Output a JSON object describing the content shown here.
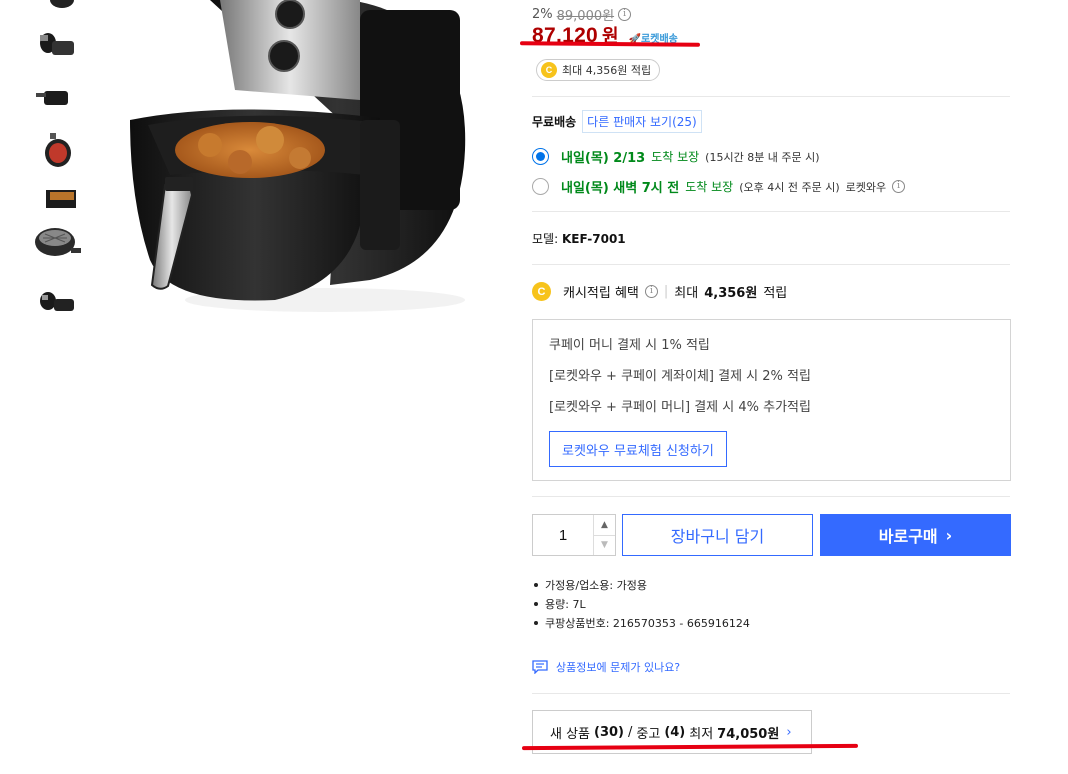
{
  "thumbnails": [
    {
      "icon": "airfryer-top-thumb"
    },
    {
      "icon": "airfryer-basket-thumb"
    },
    {
      "icon": "airfryer-drawer-thumb"
    },
    {
      "icon": "airfryer-red-thumb"
    },
    {
      "icon": "airfryer-food-thumb"
    },
    {
      "icon": "airfryer-basket-open-thumb"
    },
    {
      "icon": "airfryer-parts-thumb"
    }
  ],
  "price": {
    "discount": "2%",
    "original": "89,000원",
    "info_icon": "i",
    "sale": "87,120",
    "currency": "원",
    "rocket_badge": "🚀로켓배송",
    "annotation_color": "#e60012"
  },
  "cash_pill": {
    "coin": "C",
    "text": "최대 4,356원 적립"
  },
  "shipping": {
    "label": "무료배송",
    "other_sellers": "다른 판매자 보기(25)",
    "options": [
      {
        "selected": true,
        "day": "내일(목) 2/13",
        "guarantee": "도착 보장",
        "note": "(15시간 8분 내 주문 시)",
        "extra": ""
      },
      {
        "selected": false,
        "day": "내일(목) 새벽 7시 전",
        "guarantee": "도착 보장",
        "note": "(오후 4시 전 주문 시)",
        "extra": "로켓와우"
      }
    ]
  },
  "model": {
    "label": "모델:",
    "value": "KEF-7001"
  },
  "cash_benefit": {
    "coin": "C",
    "label": "캐시적립 혜택",
    "info_icon": "i",
    "separator": "|",
    "max_prefix": "최대",
    "max_amount": "4,356원",
    "max_suffix": "적립"
  },
  "benefits": [
    "쿠페이 머니 결제 시 1% 적립",
    "[로켓와우 + 쿠페이 계좌이체] 결제 시 2% 적립",
    "[로켓와우 + 쿠페이 머니] 결제 시 4% 추가적립"
  ],
  "trial_button": "로켓와우 무료체험 신청하기",
  "quantity": {
    "value": "1",
    "up": "▲",
    "down": "▼"
  },
  "cart_button": "장바구니 담기",
  "buy_button": {
    "label": "바로구매",
    "arrow": "›"
  },
  "specs": [
    "가정용/업소용: 가정용",
    "용량: 7L",
    "쿠팡상품번호: 216570353 - 665916124"
  ],
  "report_link": "상품정보에 문제가 있나요?",
  "offers": {
    "new_label": "새 상품",
    "new_count": "(30)",
    "slash": "/",
    "used_label": "중고",
    "used_count": "(4)",
    "lowest_label": "최저",
    "lowest_price": "74,050원",
    "arrow": "›"
  },
  "colors": {
    "accent_blue": "#346aff",
    "price_red": "#ae0000",
    "delivery_green": "#00891a"
  }
}
